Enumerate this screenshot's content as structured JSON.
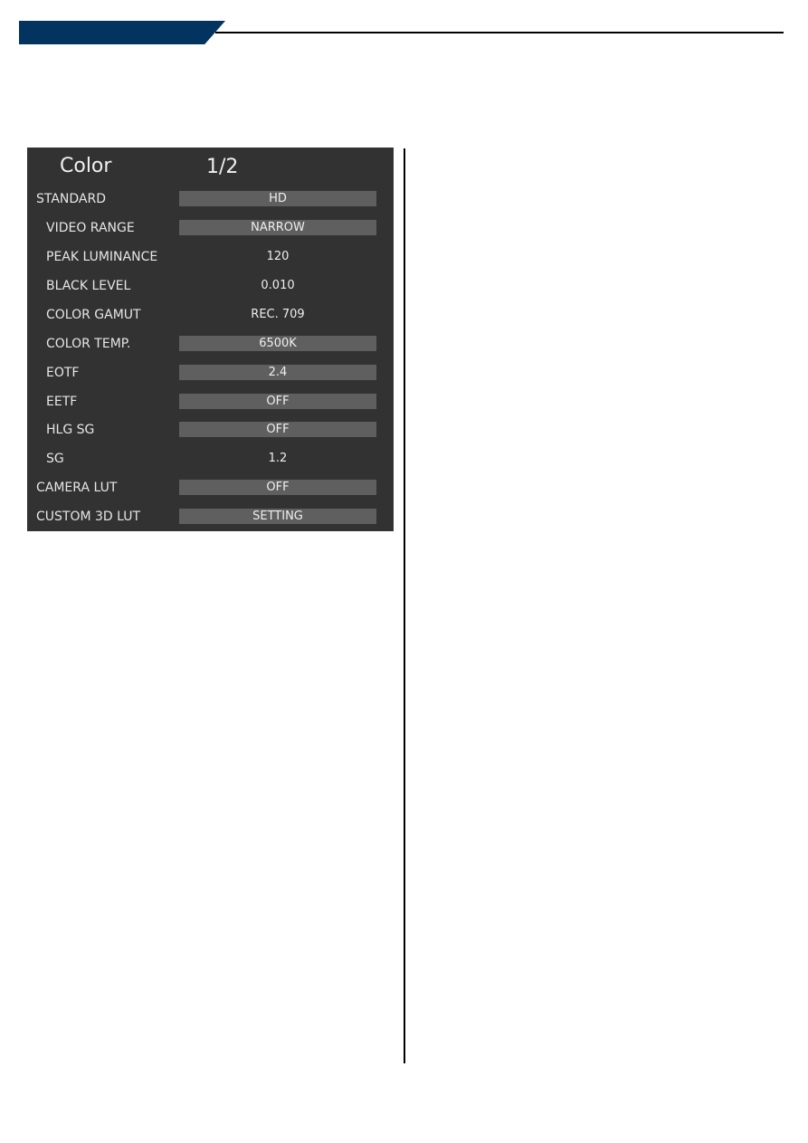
{
  "header": {
    "accent_color": "#03335f"
  },
  "menu": {
    "title": "Color",
    "page": "1/2",
    "rows": [
      {
        "label": "STANDARD",
        "value": "HD",
        "level": "top",
        "boxed": true
      },
      {
        "label": "VIDEO RANGE",
        "value": "NARROW",
        "level": "sub",
        "boxed": true
      },
      {
        "label": "PEAK LUMINANCE",
        "value": "120",
        "level": "sub",
        "boxed": false
      },
      {
        "label": "BLACK LEVEL",
        "value": "0.010",
        "level": "sub",
        "boxed": false
      },
      {
        "label": "COLOR GAMUT",
        "value": "REC. 709",
        "level": "sub",
        "boxed": false
      },
      {
        "label": "COLOR TEMP.",
        "value": "6500K",
        "level": "sub",
        "boxed": true
      },
      {
        "label": "EOTF",
        "value": "2.4",
        "level": "sub",
        "boxed": true
      },
      {
        "label": "EETF",
        "value": "OFF",
        "level": "sub",
        "boxed": true
      },
      {
        "label": "HLG SG",
        "value": "OFF",
        "level": "sub",
        "boxed": true
      },
      {
        "label": "SG",
        "value": "1.2",
        "level": "sub",
        "boxed": false
      },
      {
        "label": "CAMERA LUT",
        "value": "OFF",
        "level": "top",
        "boxed": true
      },
      {
        "label": "CUSTOM 3D LUT",
        "value": "SETTING",
        "level": "top",
        "boxed": true
      }
    ]
  }
}
